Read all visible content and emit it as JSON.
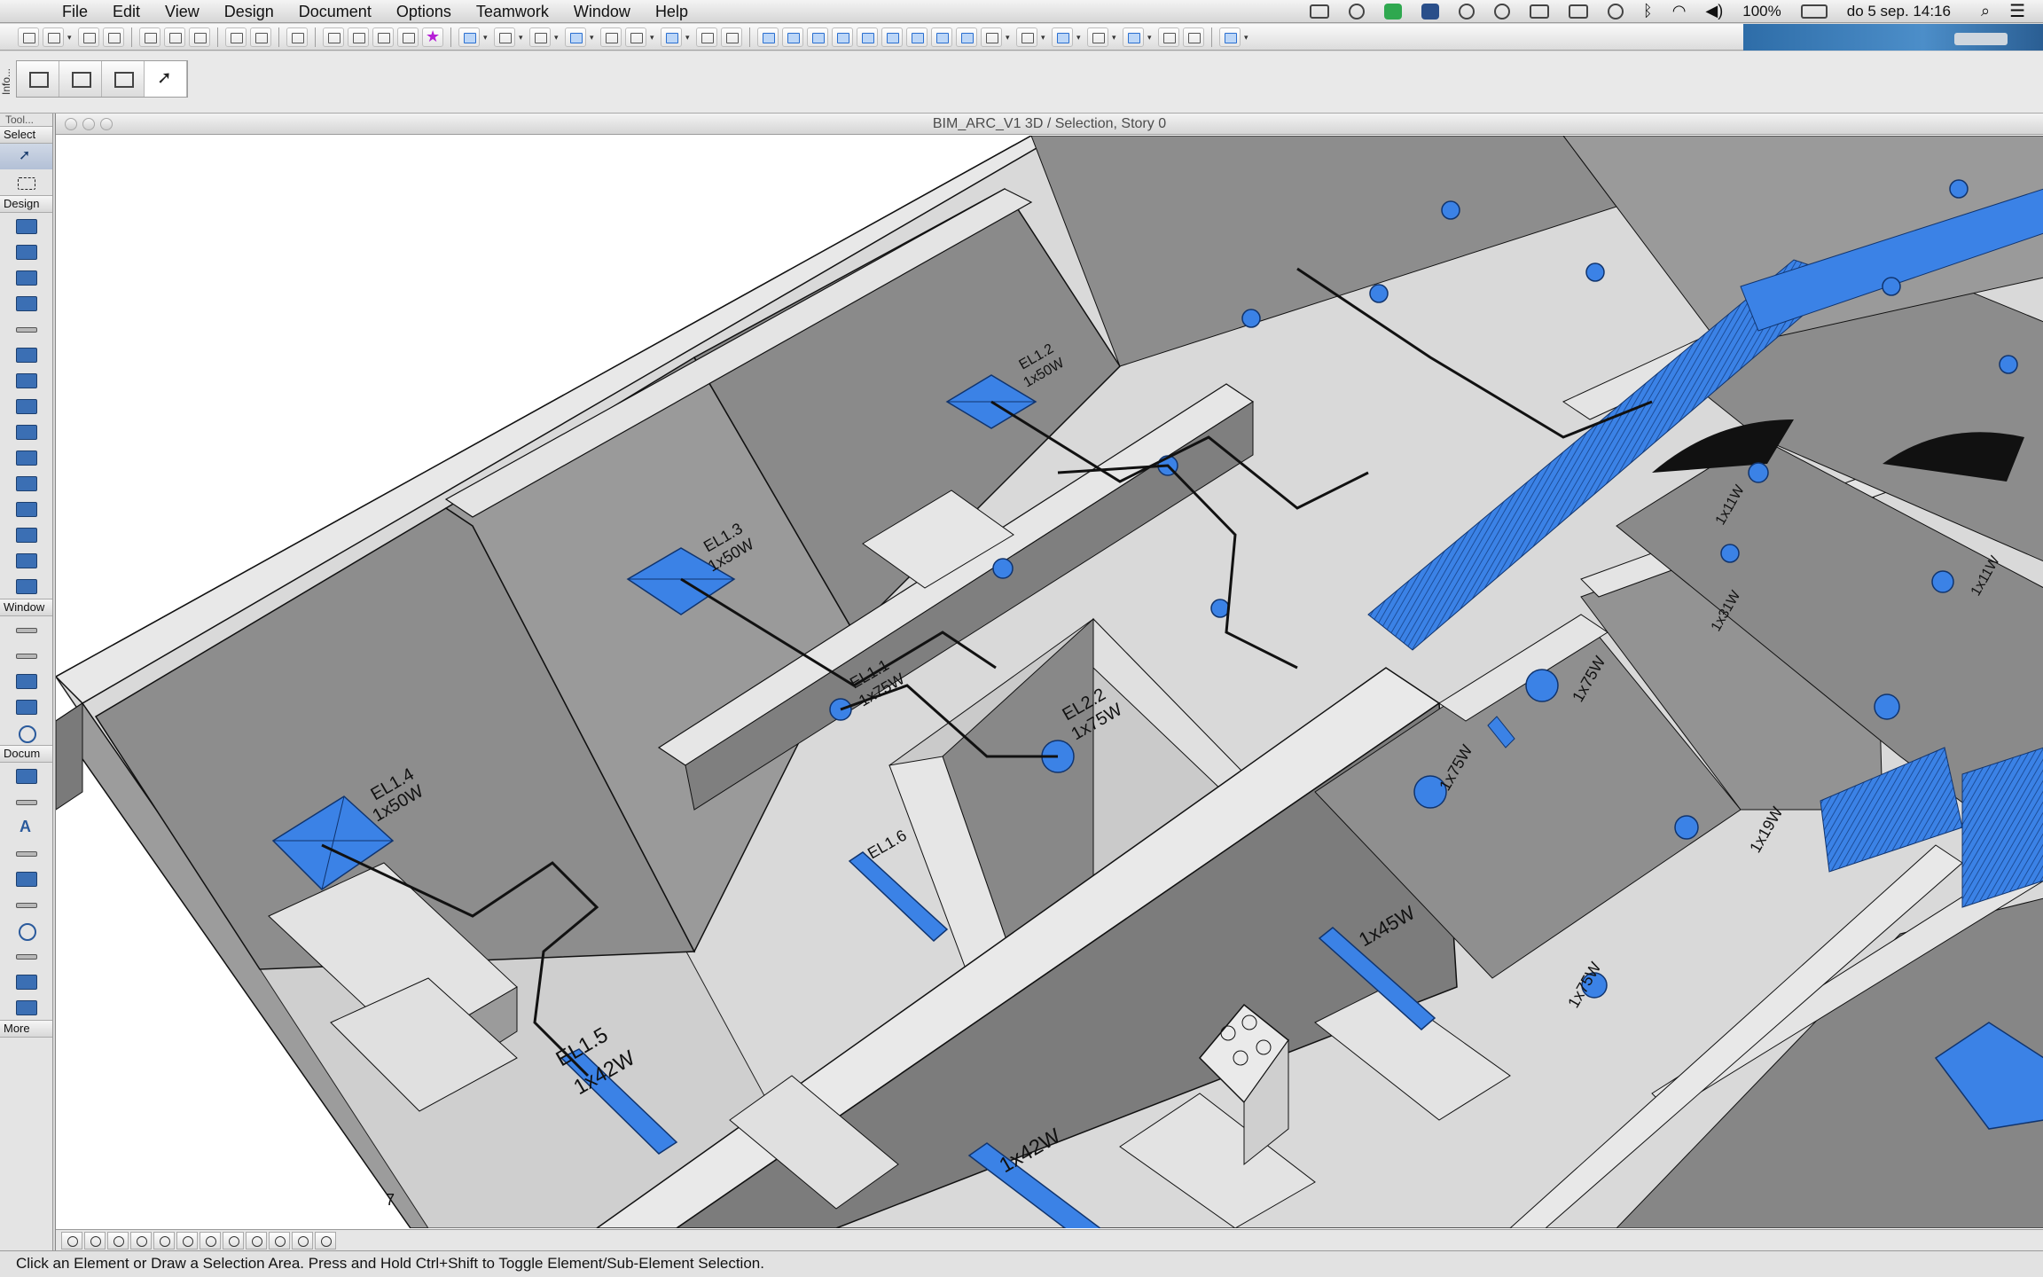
{
  "menubar": {
    "apple": "",
    "items": [
      "File",
      "Edit",
      "View",
      "Design",
      "Document",
      "Options",
      "Teamwork",
      "Window",
      "Help"
    ],
    "battery": "100%",
    "clock": "do 5 sep.  14:16"
  },
  "infobox": {
    "label": "Info..."
  },
  "toolbox": {
    "title": "Tool...",
    "sections": [
      "Select",
      "Design",
      "Window",
      "Docum",
      "More"
    ]
  },
  "window": {
    "title": "BIM_ARC_V1 3D / Selection, Story 0"
  },
  "model_labels": {
    "el14": "EL1.4",
    "el14w": "1x50W",
    "el13": "EL1.3",
    "el13w": "1x50W",
    "el12": "EL1.2",
    "el12w": "1x50W",
    "el11": "EL1.1",
    "el11w": "1x75W",
    "el22": "EL2.2",
    "el22w": "1x75W",
    "el16": "EL1.6",
    "el15": "EL1.5",
    "el15w": "1x42W",
    "w42": "1x42W",
    "w45": "1x45W",
    "w75a": "1x75W",
    "w75b": "1x75W",
    "w75c": "1x75W",
    "w11a": "1x11W",
    "w11b": "1x11W",
    "w19": "1x19W",
    "w31": "1x31W",
    "num7": "7"
  },
  "status": {
    "message": "Click an Element or Draw a Selection Area. Press and Hold Ctrl+Shift to Toggle Element/Sub-Element Selection."
  },
  "colors": {
    "accent_blue": "#3b82e6",
    "wall_gray": "#8e8e8e",
    "floor_light": "#d7d7d7"
  }
}
